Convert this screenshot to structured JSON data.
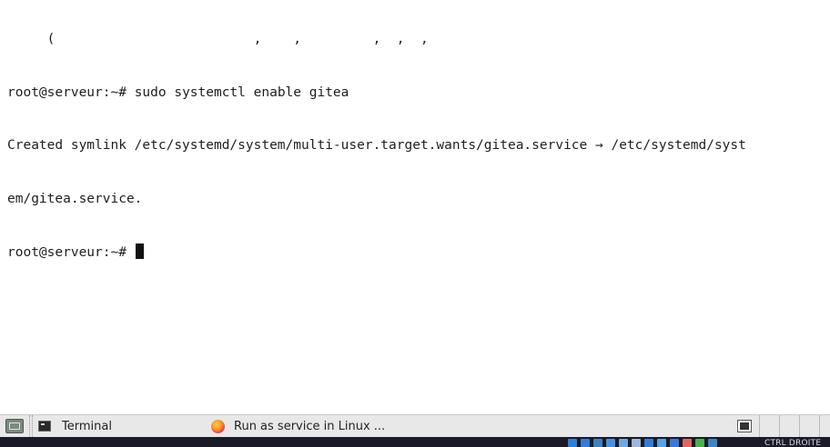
{
  "terminal": {
    "clipped_line": "     (                         ,    ,         ,  ,  ,",
    "prompt1": "root@serveur:~# ",
    "command1": "sudo systemctl enable gitea",
    "output1": "Created symlink /etc/systemd/system/multi-user.target.wants/gitea.service → /etc/systemd/syst",
    "output2": "em/gitea.service.",
    "prompt2": "root@serveur:~# "
  },
  "taskbar": {
    "tasks": [
      {
        "label": "Terminal",
        "icon": "terminal-icon"
      },
      {
        "label": "Run as service in Linux ...",
        "icon": "firefox-icon"
      }
    ],
    "desktop_icon": "show-desktop-icon",
    "tray_icon": "terminal-icon"
  },
  "bottom_panel": {
    "label": "CTRL DROITE",
    "tray_icon_colors": [
      "#2f7fd8",
      "#2f7fd8",
      "#3b82c4",
      "#4a90e2",
      "#6fa8dc",
      "#9fb7d8",
      "#2f7fd8",
      "#5aa0e6",
      "#3c78d8",
      "#e06666",
      "#4caf50",
      "#3d85c6"
    ]
  },
  "colors": {
    "terminal_bg": "#ffffff",
    "terminal_fg": "#1e1e1e",
    "taskbar_bg": "#e8e8e8",
    "bottom_panel_bg": "#1a1b26"
  }
}
